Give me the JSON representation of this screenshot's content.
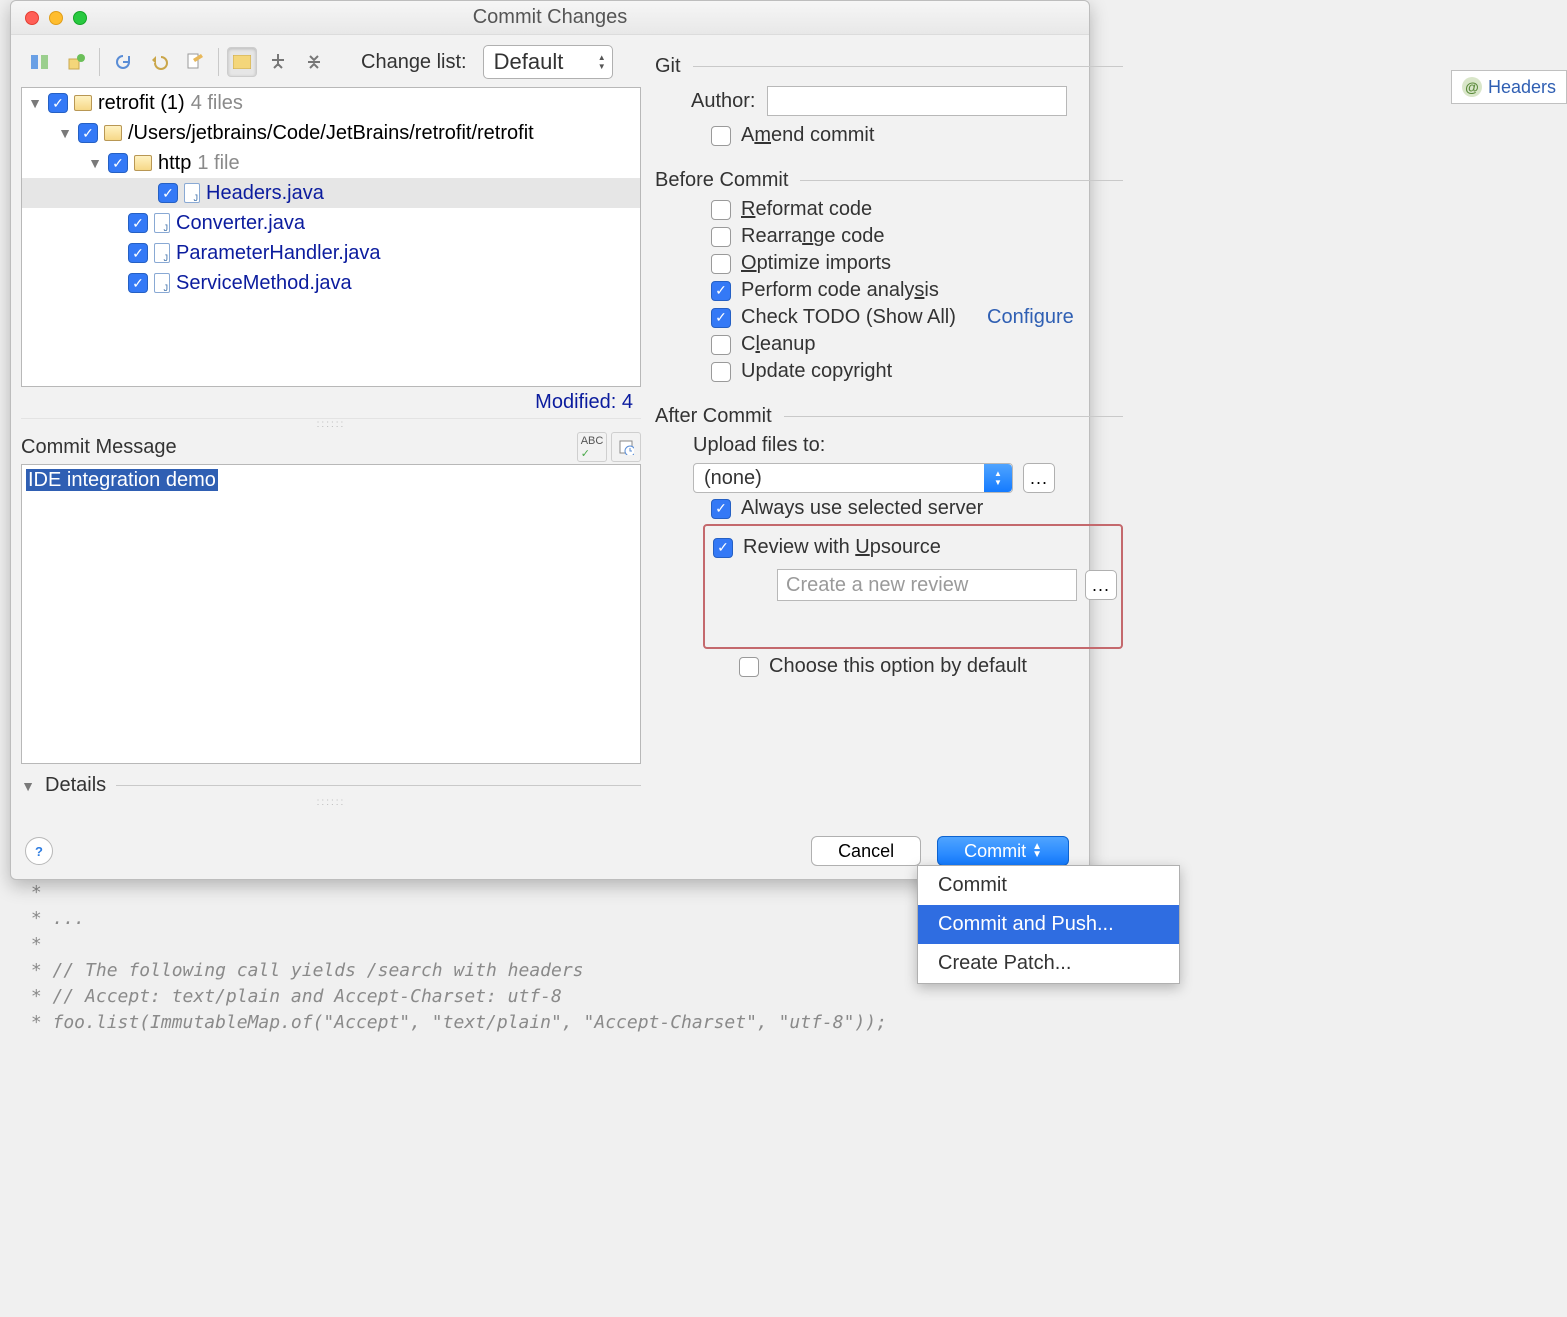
{
  "window": {
    "title": "Commit Changes"
  },
  "editor_tab": {
    "label": "Headers"
  },
  "toolbar": {
    "change_list_label": "Change list:",
    "change_list_value": "Default"
  },
  "tree": {
    "root": {
      "name": "retrofit (1)",
      "count": "4 files"
    },
    "path1": "/Users/jetbrains/Code/JetBrains/retrofit/retrofit",
    "http": {
      "name": "http",
      "count": "1 file"
    },
    "files": [
      "Headers.java",
      "Converter.java",
      "ParameterHandler.java",
      "ServiceMethod.java"
    ],
    "modified": "Modified: 4"
  },
  "commit_msg": {
    "label": "Commit Message",
    "value": "IDE integration demo"
  },
  "details": "Details",
  "git": {
    "header": "Git",
    "author_label": "Author:",
    "amend_html": "A<u>m</u>end commit"
  },
  "before": {
    "header": "Before Commit",
    "reformat_html": "<u>R</u>eformat code",
    "rearrange_html": "Rearra<u>n</u>ge code",
    "optimize_html": "<u>O</u>ptimize imports",
    "analysis_html": "Perform code analy<u>s</u>is",
    "todo_html": "Check TODO (Show All)",
    "configure": "Configure",
    "cleanup_html": "C<u>l</u>eanup",
    "copyright": "Update copyright"
  },
  "after": {
    "header": "After Commit",
    "upload_label": "Upload files to:",
    "upload_value": "(none)",
    "always_server": "Always use selected server",
    "review_html": "Review with <u>U</u>psource",
    "review_placeholder": "Create a new review",
    "default_opt": "Choose this option by default"
  },
  "buttons": {
    "cancel": "Cancel",
    "commit": "Commit"
  },
  "menu": {
    "commit": "Commit",
    "commit_push": "Commit and Push...",
    "patch": "Create Patch..."
  },
  "code_lines": " *\n * ...\n *\n * // The following call yields /search with headers\n * // Accept: text/plain and Accept-Charset: utf-8\n * foo.list(ImmutableMap.of(\"Accept\", \"text/plain\", \"Accept-Charset\", \"utf-8\"));"
}
